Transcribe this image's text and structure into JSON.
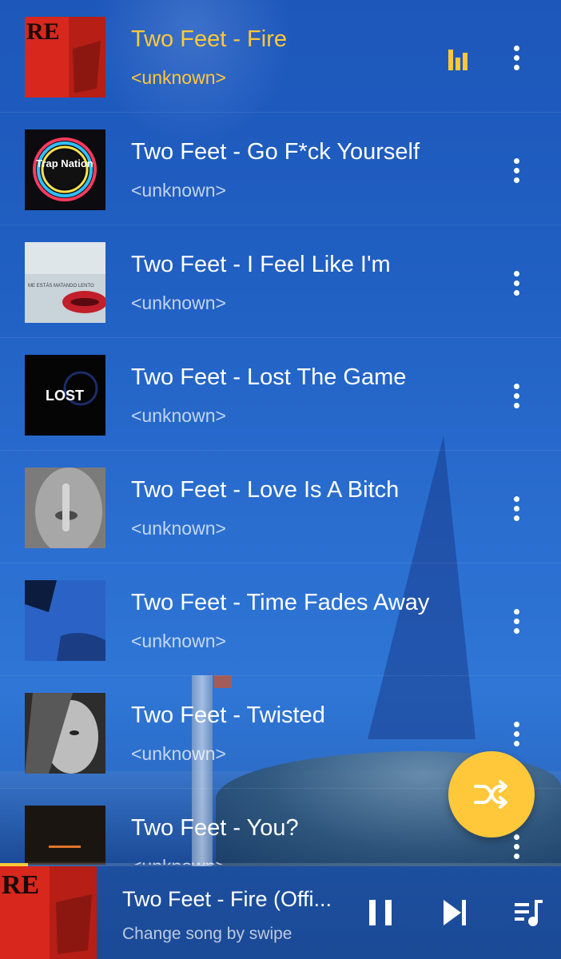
{
  "songs": [
    {
      "title": "Two Feet - Fire",
      "artist": "<unknown>",
      "active": true,
      "cover": "red-fire"
    },
    {
      "title": "Two Feet - Go F*ck Yourself",
      "artist": "<unknown>",
      "active": false,
      "cover": "trap-nation"
    },
    {
      "title": "Two Feet - I Feel Like I'm",
      "artist": "<unknown>",
      "active": false,
      "cover": "lips"
    },
    {
      "title": "Two Feet - Lost The Game",
      "artist": "<unknown>",
      "active": false,
      "cover": "lost",
      "cover_text": "LOST"
    },
    {
      "title": "Two Feet - Love Is A Bitch",
      "artist": "<unknown>",
      "active": false,
      "cover": "finger-lips"
    },
    {
      "title": "Two Feet - Time Fades Away",
      "artist": "<unknown>",
      "active": false,
      "cover": "blue-time"
    },
    {
      "title": "Two Feet - Twisted",
      "artist": "<unknown>",
      "active": false,
      "cover": "portrait"
    },
    {
      "title": "Two Feet - You?",
      "artist": "<unknown>",
      "active": false,
      "cover": "dark-stage"
    }
  ],
  "covers": {
    "lips_text": "ME ESTÁS MATANDO LENTO",
    "trap_text": "Trap Nation",
    "fire_text": "RE"
  },
  "shuffle_button": {
    "icon": "shuffle-icon"
  },
  "now_playing": {
    "title": "Two Feet - Fire (Offi...",
    "subtitle": "Change song by swipe",
    "progress": 0.05
  },
  "controls": {
    "pause": "pause-icon",
    "next": "skip-next-icon",
    "queue": "queue-music-icon"
  },
  "colors": {
    "accent": "#ffc83a",
    "text": "#ffffff",
    "muted": "rgba(255,255,255,0.72)"
  }
}
